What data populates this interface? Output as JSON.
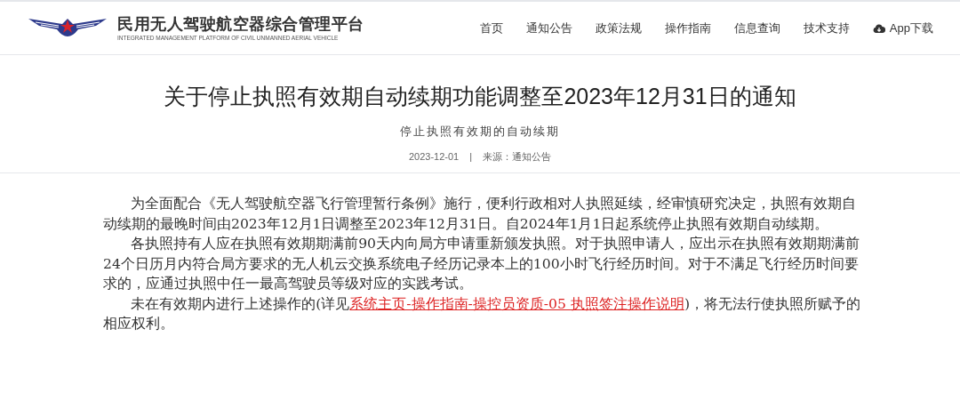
{
  "header": {
    "site_title": "民用无人驾驶航空器综合管理平台",
    "site_subtitle": "INTEGRATED MANAGEMENT PLATFORM OF CIVIL UNMANNED AERIAL VEHICLE",
    "nav": [
      {
        "label": "首页"
      },
      {
        "label": "通知公告"
      },
      {
        "label": "政策法规"
      },
      {
        "label": "操作指南"
      },
      {
        "label": "信息查询"
      },
      {
        "label": "技术支持"
      }
    ],
    "app_download": "App下载"
  },
  "article": {
    "title": "关于停止执照有效期自动续期功能调整至2023年12月31日的通知",
    "subtitle": "停止执照有效期的自动续期",
    "date": "2023-12-01",
    "separator": "|",
    "source": "来源：通知公告",
    "paragraphs": [
      {
        "text": "为全面配合《无人驾驶航空器飞行管理暂行条例》施行，便利行政相对人执照延续，经审慎研究决定，执照有效期自动续期的最晚时间由2023年12月1日调整至2023年12月31日。自2024年1月1日起系统停止执照有效期自动续期。"
      },
      {
        "text": "各执照持有人应在执照有效期期满前90天内向局方申请重新颁发执照。对于执照申请人，应出示在执照有效期期满前24个日历月内符合局方要求的无人机云交换系统电子经历记录本上的100小时飞行经历时间。对于不满足飞行经历时间要求的，应通过执照中任一最高驾驶员等级对应的实践考试。"
      },
      {
        "text": "未在有效期内进行上述操作的(详见",
        "link": "系统主页-操作指南-操控员资质-05 执照签注操作说明",
        "text_after": ")，将无法行使执照所赋予的相应权利。"
      }
    ]
  }
}
